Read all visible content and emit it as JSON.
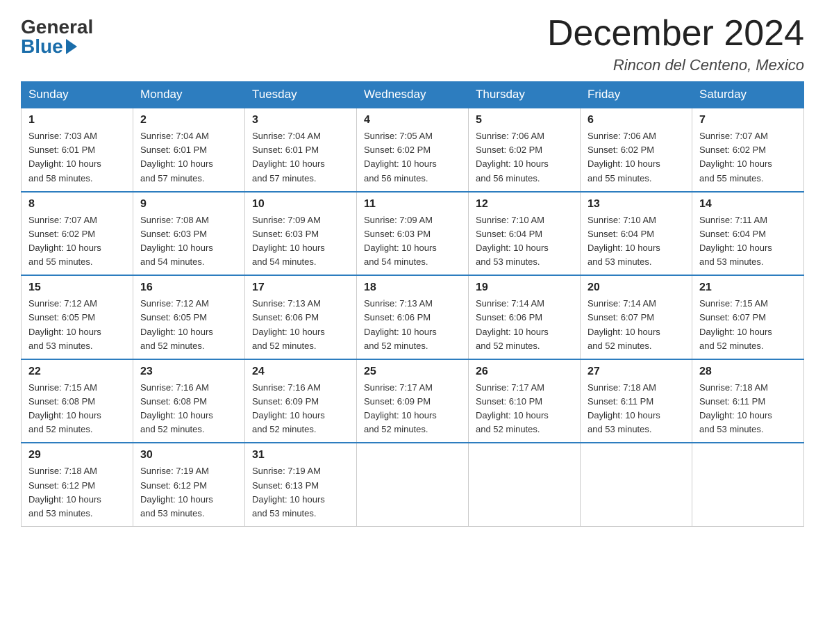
{
  "logo": {
    "general": "General",
    "blue": "Blue"
  },
  "header": {
    "month_year": "December 2024",
    "location": "Rincon del Centeno, Mexico"
  },
  "columns": [
    "Sunday",
    "Monday",
    "Tuesday",
    "Wednesday",
    "Thursday",
    "Friday",
    "Saturday"
  ],
  "weeks": [
    [
      {
        "day": "1",
        "sunrise": "7:03 AM",
        "sunset": "6:01 PM",
        "daylight": "10 hours and 58 minutes."
      },
      {
        "day": "2",
        "sunrise": "7:04 AM",
        "sunset": "6:01 PM",
        "daylight": "10 hours and 57 minutes."
      },
      {
        "day": "3",
        "sunrise": "7:04 AM",
        "sunset": "6:01 PM",
        "daylight": "10 hours and 57 minutes."
      },
      {
        "day": "4",
        "sunrise": "7:05 AM",
        "sunset": "6:02 PM",
        "daylight": "10 hours and 56 minutes."
      },
      {
        "day": "5",
        "sunrise": "7:06 AM",
        "sunset": "6:02 PM",
        "daylight": "10 hours and 56 minutes."
      },
      {
        "day": "6",
        "sunrise": "7:06 AM",
        "sunset": "6:02 PM",
        "daylight": "10 hours and 55 minutes."
      },
      {
        "day": "7",
        "sunrise": "7:07 AM",
        "sunset": "6:02 PM",
        "daylight": "10 hours and 55 minutes."
      }
    ],
    [
      {
        "day": "8",
        "sunrise": "7:07 AM",
        "sunset": "6:02 PM",
        "daylight": "10 hours and 55 minutes."
      },
      {
        "day": "9",
        "sunrise": "7:08 AM",
        "sunset": "6:03 PM",
        "daylight": "10 hours and 54 minutes."
      },
      {
        "day": "10",
        "sunrise": "7:09 AM",
        "sunset": "6:03 PM",
        "daylight": "10 hours and 54 minutes."
      },
      {
        "day": "11",
        "sunrise": "7:09 AM",
        "sunset": "6:03 PM",
        "daylight": "10 hours and 54 minutes."
      },
      {
        "day": "12",
        "sunrise": "7:10 AM",
        "sunset": "6:04 PM",
        "daylight": "10 hours and 53 minutes."
      },
      {
        "day": "13",
        "sunrise": "7:10 AM",
        "sunset": "6:04 PM",
        "daylight": "10 hours and 53 minutes."
      },
      {
        "day": "14",
        "sunrise": "7:11 AM",
        "sunset": "6:04 PM",
        "daylight": "10 hours and 53 minutes."
      }
    ],
    [
      {
        "day": "15",
        "sunrise": "7:12 AM",
        "sunset": "6:05 PM",
        "daylight": "10 hours and 53 minutes."
      },
      {
        "day": "16",
        "sunrise": "7:12 AM",
        "sunset": "6:05 PM",
        "daylight": "10 hours and 52 minutes."
      },
      {
        "day": "17",
        "sunrise": "7:13 AM",
        "sunset": "6:06 PM",
        "daylight": "10 hours and 52 minutes."
      },
      {
        "day": "18",
        "sunrise": "7:13 AM",
        "sunset": "6:06 PM",
        "daylight": "10 hours and 52 minutes."
      },
      {
        "day": "19",
        "sunrise": "7:14 AM",
        "sunset": "6:06 PM",
        "daylight": "10 hours and 52 minutes."
      },
      {
        "day": "20",
        "sunrise": "7:14 AM",
        "sunset": "6:07 PM",
        "daylight": "10 hours and 52 minutes."
      },
      {
        "day": "21",
        "sunrise": "7:15 AM",
        "sunset": "6:07 PM",
        "daylight": "10 hours and 52 minutes."
      }
    ],
    [
      {
        "day": "22",
        "sunrise": "7:15 AM",
        "sunset": "6:08 PM",
        "daylight": "10 hours and 52 minutes."
      },
      {
        "day": "23",
        "sunrise": "7:16 AM",
        "sunset": "6:08 PM",
        "daylight": "10 hours and 52 minutes."
      },
      {
        "day": "24",
        "sunrise": "7:16 AM",
        "sunset": "6:09 PM",
        "daylight": "10 hours and 52 minutes."
      },
      {
        "day": "25",
        "sunrise": "7:17 AM",
        "sunset": "6:09 PM",
        "daylight": "10 hours and 52 minutes."
      },
      {
        "day": "26",
        "sunrise": "7:17 AM",
        "sunset": "6:10 PM",
        "daylight": "10 hours and 52 minutes."
      },
      {
        "day": "27",
        "sunrise": "7:18 AM",
        "sunset": "6:11 PM",
        "daylight": "10 hours and 53 minutes."
      },
      {
        "day": "28",
        "sunrise": "7:18 AM",
        "sunset": "6:11 PM",
        "daylight": "10 hours and 53 minutes."
      }
    ],
    [
      {
        "day": "29",
        "sunrise": "7:18 AM",
        "sunset": "6:12 PM",
        "daylight": "10 hours and 53 minutes."
      },
      {
        "day": "30",
        "sunrise": "7:19 AM",
        "sunset": "6:12 PM",
        "daylight": "10 hours and 53 minutes."
      },
      {
        "day": "31",
        "sunrise": "7:19 AM",
        "sunset": "6:13 PM",
        "daylight": "10 hours and 53 minutes."
      },
      null,
      null,
      null,
      null
    ]
  ],
  "labels": {
    "sunrise": "Sunrise: ",
    "sunset": "Sunset: ",
    "daylight": "Daylight: "
  }
}
